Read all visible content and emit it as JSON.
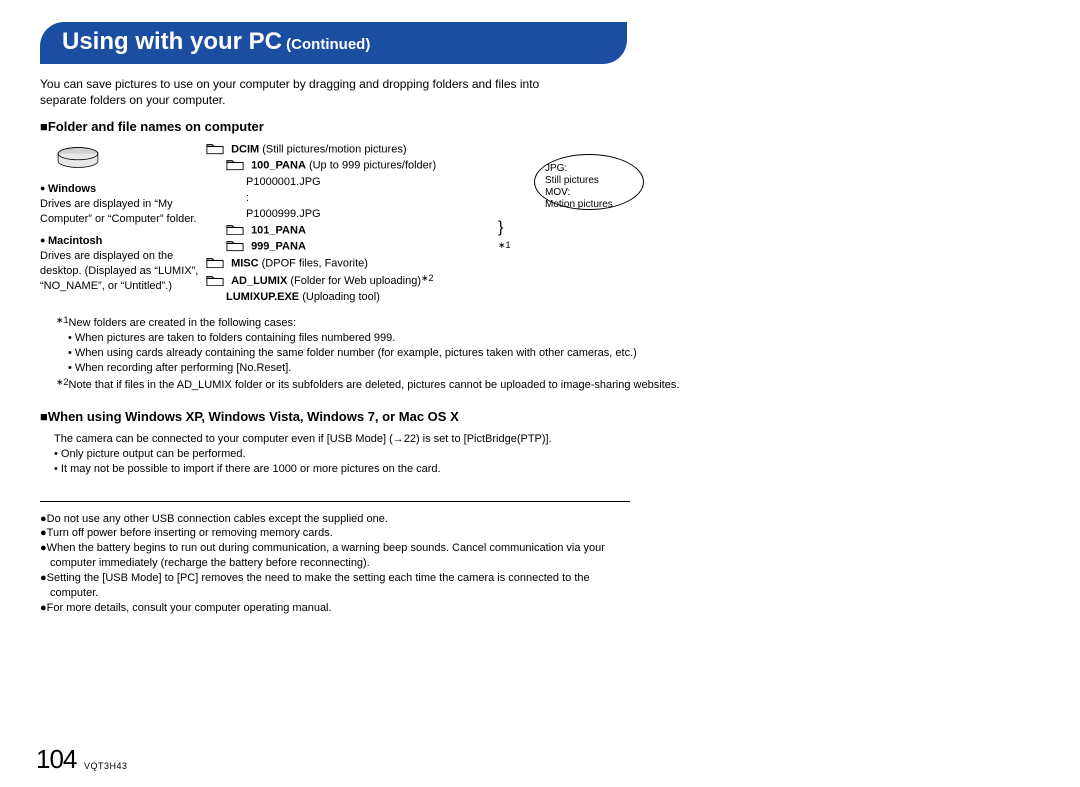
{
  "title": {
    "main": "Using with your PC",
    "cont": " (Continued)"
  },
  "intro": "You can save pictures to use on your computer by dragging and dropping folders and files into separate folders on your computer.",
  "section1": {
    "heading": "■Folder and file names on computer",
    "windows_label": "Windows",
    "windows_text": "Drives are displayed in “My Computer” or “Computer” folder.",
    "mac_label": "Macintosh",
    "mac_text": "Drives are displayed on the desktop. (Displayed as “LUMIX”, “NO_NAME”, or “Untitled”.)",
    "tree": {
      "dcim": "DCIM",
      "dcim_desc": " (Still pictures/motion pictures)",
      "pana100": "100_PANA",
      "pana100_desc": " (Up to 999 pictures/folder)",
      "file_first": "P1000001.JPG",
      "file_colon": ":",
      "file_last": "P1000999.JPG",
      "pana101": "101_PANA",
      "pana999": "999_PANA",
      "misc": "MISC",
      "misc_desc": " (DPOF files, Favorite)",
      "adlumix": "AD_LUMIX",
      "adlumix_desc": " (Folder for Web uploading)",
      "adlumix_sup": "∗2",
      "lumixup": "LUMIXUP.EXE",
      "lumixup_desc": " (Uploading tool)",
      "brace_sup": "∗1"
    },
    "balloon": {
      "l1": "JPG:",
      "l2": "Still pictures",
      "l3": "MOV:",
      "l4": "Motion pictures"
    }
  },
  "footnotes": {
    "f1_sup": "∗1",
    "f1_lead": "New folders are created in the following cases:",
    "f1_b1": "• When pictures are taken to folders containing files numbered 999.",
    "f1_b2": "• When using cards already containing the same folder number (for example, pictures taken with other cameras, etc.)",
    "f1_b3": "• When recording after performing [No.Reset].",
    "f2_sup": "∗2",
    "f2_text": "Note that if files in the AD_LUMIX folder or its subfolders are deleted, pictures cannot be uploaded to image-sharing websites."
  },
  "section2": {
    "heading": "■When using Windows XP, Windows Vista, Windows 7, or Mac OS X",
    "body1": "The camera can be connected to your computer even if [USB Mode] (→22) is set to [PictBridge(PTP)].",
    "b1": "• Only picture output can be performed.",
    "b2": "• It may not be possible to import if there are 1000 or more pictures on the card."
  },
  "notes": {
    "n1": "●Do not use any other USB connection cables except the supplied one.",
    "n2": "●Turn off power before inserting or removing memory cards.",
    "n3": "●When the battery begins to run out during communication, a warning beep sounds. Cancel communication via your computer immediately (recharge the battery before reconnecting).",
    "n4": "●Setting the [USB Mode] to [PC] removes the need to make the setting each time the camera is connected to the computer.",
    "n5": "●For more details, consult your computer operating manual."
  },
  "page_number": "104",
  "doc_code": "VQT3H43"
}
